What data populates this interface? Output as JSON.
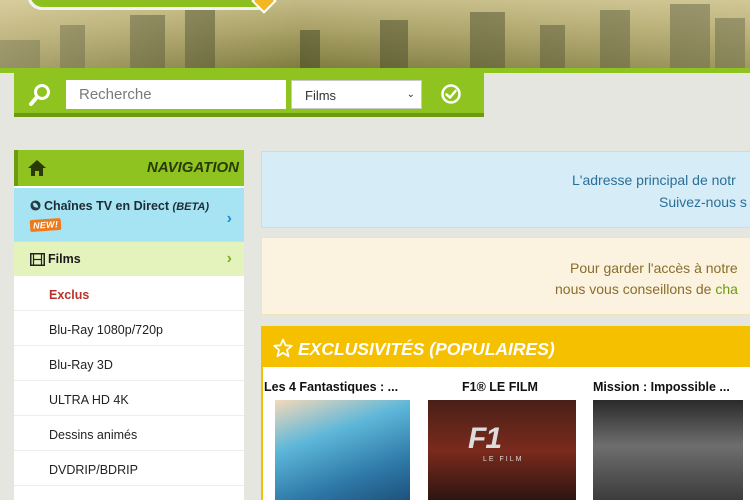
{
  "search": {
    "placeholder": "Recherche",
    "category": "Films"
  },
  "nav": {
    "title": "NAVIGATION",
    "live": {
      "label": "Chaînes TV en Direct",
      "beta": "(BETA)",
      "badge": "NEW!"
    },
    "films": {
      "label": "Films"
    },
    "items": [
      {
        "label": "Exclus",
        "active": true
      },
      {
        "label": "Blu-Ray 1080p/720p"
      },
      {
        "label": "Blu-Ray 3D"
      },
      {
        "label": "ULTRA HD 4K"
      },
      {
        "label": "Dessins animés"
      },
      {
        "label": "DVDRIP/BDRIP"
      }
    ]
  },
  "notices": {
    "blue": {
      "line1": "L'adresse principal de notr",
      "line2": "Suivez-nous s"
    },
    "yellow": {
      "line1": "Pour garder l'accès à notre",
      "line2_pre": "nous vous conseillons de ",
      "line2_hl": "cha"
    }
  },
  "exclusives": {
    "title": "EXCLUSIVITÉS (POPULAIRES)",
    "movies": [
      {
        "title": "Les 4 Fantastiques : ..."
      },
      {
        "title": "F1® LE FILM",
        "poster_text": "F1",
        "poster_sub": "LE FILM"
      },
      {
        "title": "Mission : Impossible ..."
      }
    ]
  },
  "colors": {
    "brand_green": "#8fc31f",
    "accent_yellow": "#f4c000",
    "info_blue": "#d6ecf6",
    "info_yellow": "#fbf3df",
    "active_red": "#b7322b"
  }
}
